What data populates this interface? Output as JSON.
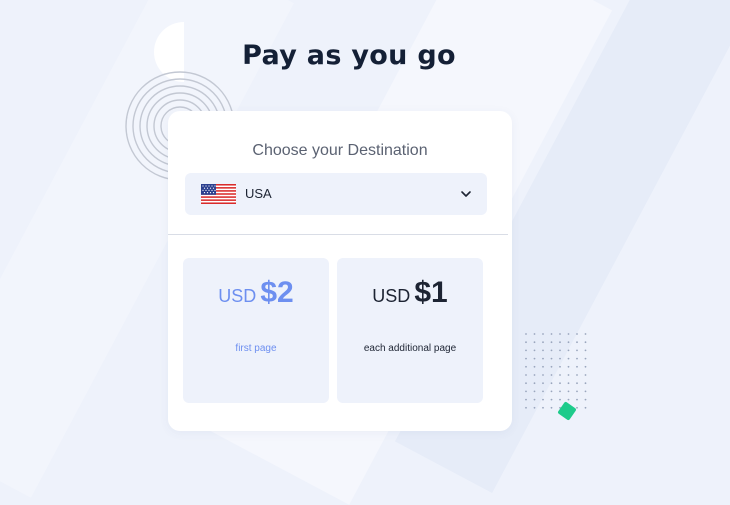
{
  "page": {
    "title": "Pay as you go"
  },
  "destination": {
    "label": "Choose your Destination",
    "selected_country": "USA",
    "selected_flag": "us-flag-icon"
  },
  "pricing": [
    {
      "currency": "USD",
      "amount": "$2",
      "note": "first page"
    },
    {
      "currency": "USD",
      "amount": "$1",
      "note": "each additional page"
    }
  ],
  "colors": {
    "background": "#eef2fb",
    "accent_blue": "#6d8ff0",
    "text_dark": "#1d2433",
    "green_accent": "#1ecb8b"
  }
}
